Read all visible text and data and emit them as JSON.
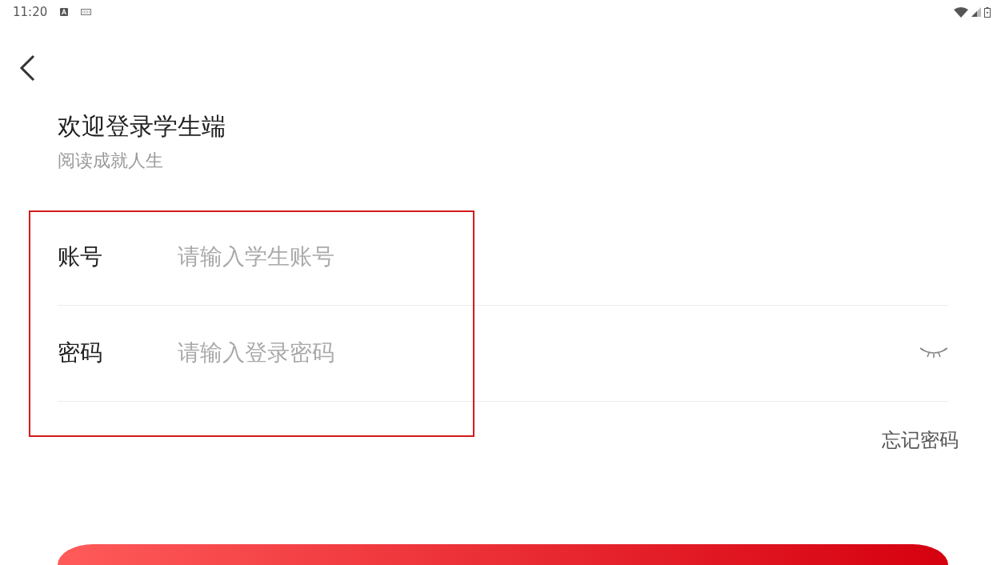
{
  "status_bar": {
    "time": "11:20"
  },
  "title": "欢迎登录学生端",
  "subtitle": "阅读成就人生",
  "fields": [
    {
      "kind": "text",
      "label": "账号",
      "placeholder": "请输入学生账号"
    },
    {
      "kind": "password",
      "label": "密码",
      "placeholder": "请输入登录密码"
    }
  ],
  "fields_highlighted": true,
  "forgot_link": "忘记密码"
}
